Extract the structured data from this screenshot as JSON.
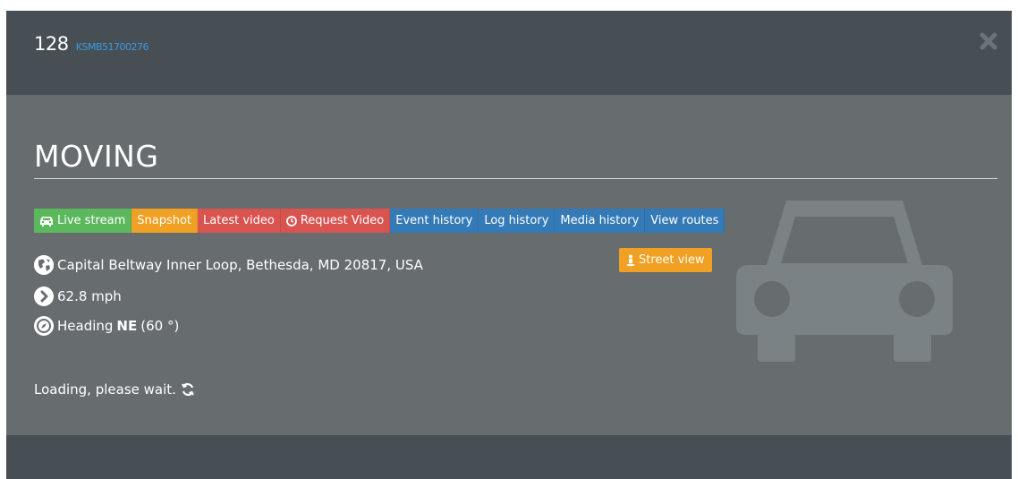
{
  "header": {
    "vehicle_number": "128",
    "vehicle_id": "KSMB51700276"
  },
  "body": {
    "status": "MOVING",
    "buttons": [
      {
        "label": "Live stream",
        "icon": "car-icon",
        "color": "#5cb85c"
      },
      {
        "label": "Snapshot",
        "icon": "",
        "color": "#f0a022"
      },
      {
        "label": "Latest video",
        "icon": "",
        "color": "#d9534f"
      },
      {
        "label": "Request Video",
        "icon": "clock-icon",
        "color": "#d9534f"
      },
      {
        "label": "Event history",
        "icon": "",
        "color": "#337ab7"
      },
      {
        "label": "Log history",
        "icon": "",
        "color": "#337ab7"
      },
      {
        "label": "Media history",
        "icon": "",
        "color": "#337ab7"
      },
      {
        "label": "View routes",
        "icon": "",
        "color": "#337ab7"
      }
    ],
    "address": "Capital Beltway Inner Loop, Bethesda, MD 20817, USA",
    "street_view_label": "Street view",
    "speed": "62.8 mph",
    "heading_prefix": "Heading",
    "heading_direction": "NE",
    "heading_degrees": "(60 °)",
    "loading_text": "Loading, please wait."
  },
  "colors": {
    "header_bg": "#474f55",
    "body_bg": "#676c6f",
    "link_blue": "#3b9ae1"
  }
}
